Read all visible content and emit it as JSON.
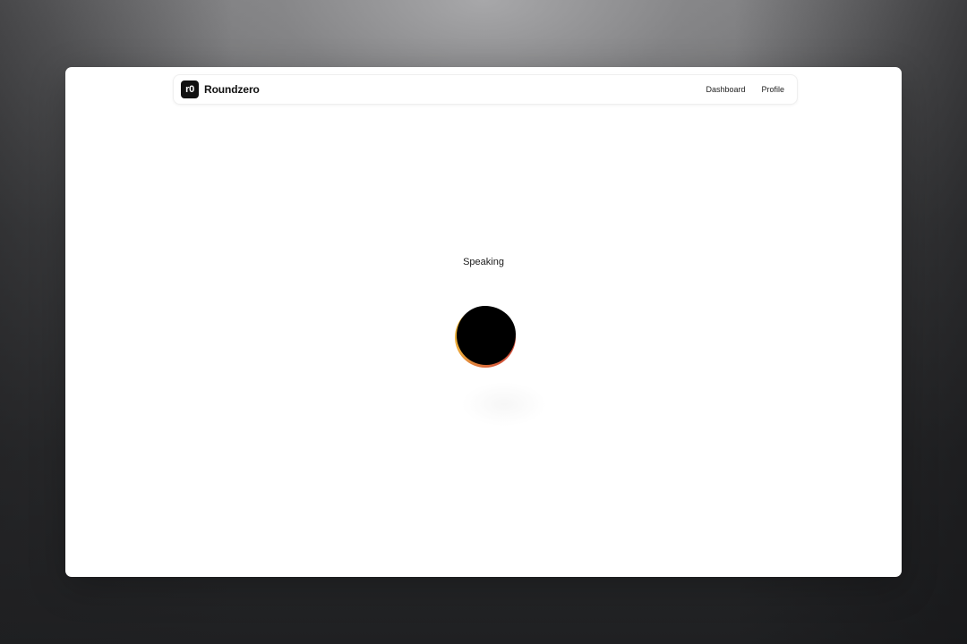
{
  "app": {
    "logo_text": "r0",
    "brand_name": "Roundzero"
  },
  "nav": {
    "items": [
      {
        "label": "Dashboard"
      },
      {
        "label": "Profile"
      }
    ]
  },
  "main": {
    "status": "Speaking",
    "orb": {
      "state": "speaking",
      "color": "#000000",
      "glow_colors": [
        "#f4d23a",
        "#e9a23a",
        "#d14a3a"
      ]
    }
  }
}
